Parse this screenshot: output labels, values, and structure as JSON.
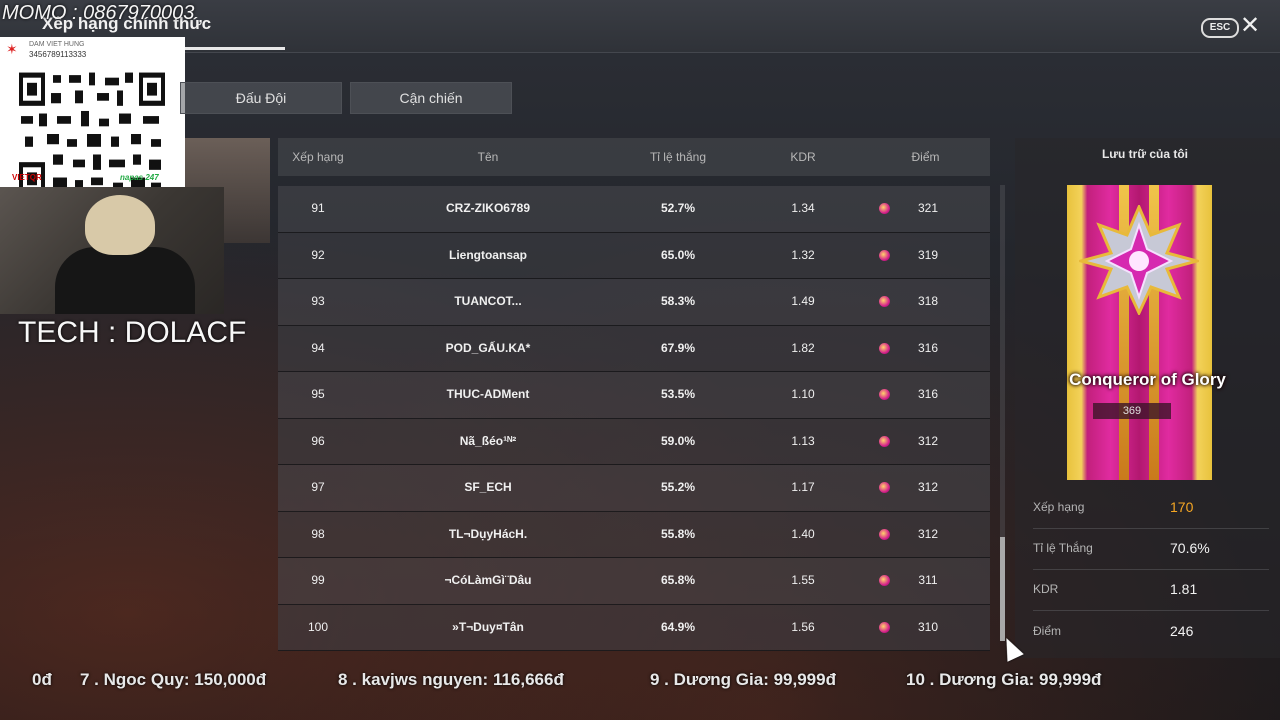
{
  "header": {
    "title": "Xếp hạng chính thức",
    "esc_label": "ESC",
    "close_glyph": "✕"
  },
  "overlay": {
    "momo": "MOMO : 0867970003",
    "qr": {
      "name": "DAM VIET HUNG",
      "account": "3456789113333",
      "bank": "VIETQR",
      "network": "napas 247"
    },
    "tech": "TECH : DOLACF"
  },
  "tabs": [
    "Đấu Đội",
    "Cận chiến"
  ],
  "table": {
    "headers": {
      "rank": "Xếp hạng",
      "name": "Tên",
      "winrate": "Tỉ lệ thắng",
      "kdr": "KDR",
      "points": "Điểm"
    },
    "rows": [
      {
        "rank": "91",
        "name": "CRZ-ZIKO6789",
        "winrate": "52.7%",
        "kdr": "1.34",
        "points": "321"
      },
      {
        "rank": "92",
        "name": "Liengtoansap",
        "winrate": "65.0%",
        "kdr": "1.32",
        "points": "319"
      },
      {
        "rank": "93",
        "name": "TUANCOT...",
        "winrate": "58.3%",
        "kdr": "1.49",
        "points": "318"
      },
      {
        "rank": "94",
        "name": "POD_GẤU.KA*",
        "winrate": "67.9%",
        "kdr": "1.82",
        "points": "316"
      },
      {
        "rank": "95",
        "name": "THUC-ADMent",
        "winrate": "53.5%",
        "kdr": "1.10",
        "points": "316"
      },
      {
        "rank": "96",
        "name": "Nã_ßéo¹ᴺ²",
        "winrate": "59.0%",
        "kdr": "1.13",
        "points": "312"
      },
      {
        "rank": "97",
        "name": "SF_ECH",
        "winrate": "55.2%",
        "kdr": "1.17",
        "points": "312"
      },
      {
        "rank": "98",
        "name": "TL¬DụyHácH.",
        "winrate": "55.8%",
        "kdr": "1.40",
        "points": "312"
      },
      {
        "rank": "99",
        "name": "¬CóLàmGì¨Dâu",
        "winrate": "65.8%",
        "kdr": "1.55",
        "points": "311"
      },
      {
        "rank": "100",
        "name": "»T¬Duy¤Tân",
        "winrate": "64.9%",
        "kdr": "1.56",
        "points": "310"
      }
    ]
  },
  "my_record": {
    "title": "Lưu trữ của tôi",
    "rank_name": "Conqueror of Glory",
    "rank_points": "369",
    "stats": [
      {
        "label": "Xếp hạng",
        "value": "170",
        "highlight": true
      },
      {
        "label": "Tỉ lệ Thắng",
        "value": "70.6%"
      },
      {
        "label": "KDR",
        "value": "1.81"
      },
      {
        "label": "Điểm",
        "value": "246"
      }
    ]
  },
  "ticker": [
    "0đ",
    "7 . Ngoc Quy: 150,000đ",
    "8 . kavjws nguyen: 116,666đ",
    "9 . Dương Gia: 99,999đ",
    "10 . Dương Gia: 99,999đ"
  ]
}
